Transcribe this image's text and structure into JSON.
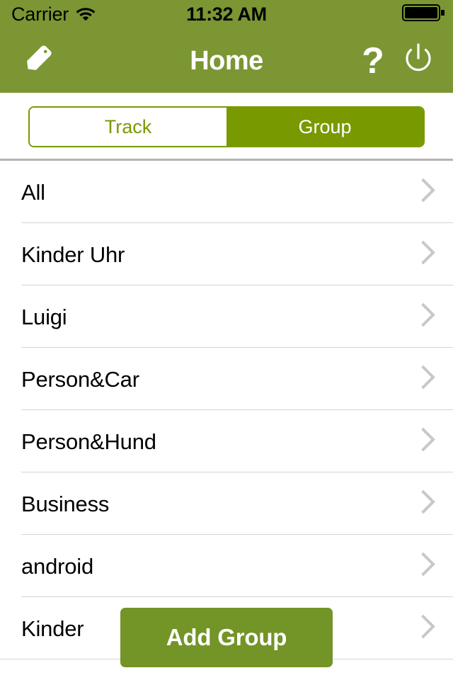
{
  "status_bar": {
    "carrier": "Carrier",
    "wifi_icon": "wifi-icon",
    "time": "11:32 AM",
    "battery_icon": "battery-full-icon"
  },
  "nav_bar": {
    "title": "Home",
    "edit_icon": "pencil-icon",
    "help_label": "?",
    "power_icon": "power-icon",
    "background_color": "#7b9633"
  },
  "segmented_control": {
    "segments": [
      {
        "label": "Track",
        "selected": false
      },
      {
        "label": "Group",
        "selected": true
      }
    ],
    "accent_color": "#789a00"
  },
  "list": {
    "rows": [
      {
        "label": "All",
        "chevron": "chevron-right-icon"
      },
      {
        "label": "Kinder Uhr",
        "chevron": "chevron-right-icon"
      },
      {
        "label": "Luigi",
        "chevron": "chevron-right-icon"
      },
      {
        "label": "Person&Car",
        "chevron": "chevron-right-icon"
      },
      {
        "label": "Person&Hund",
        "chevron": "chevron-right-icon"
      },
      {
        "label": "Business",
        "chevron": "chevron-right-icon"
      },
      {
        "label": "android",
        "chevron": "chevron-right-icon"
      },
      {
        "label": "Kinder",
        "chevron": "chevron-right-icon"
      }
    ]
  },
  "add_group_button": {
    "label": "Add Group",
    "color": "#739426"
  }
}
